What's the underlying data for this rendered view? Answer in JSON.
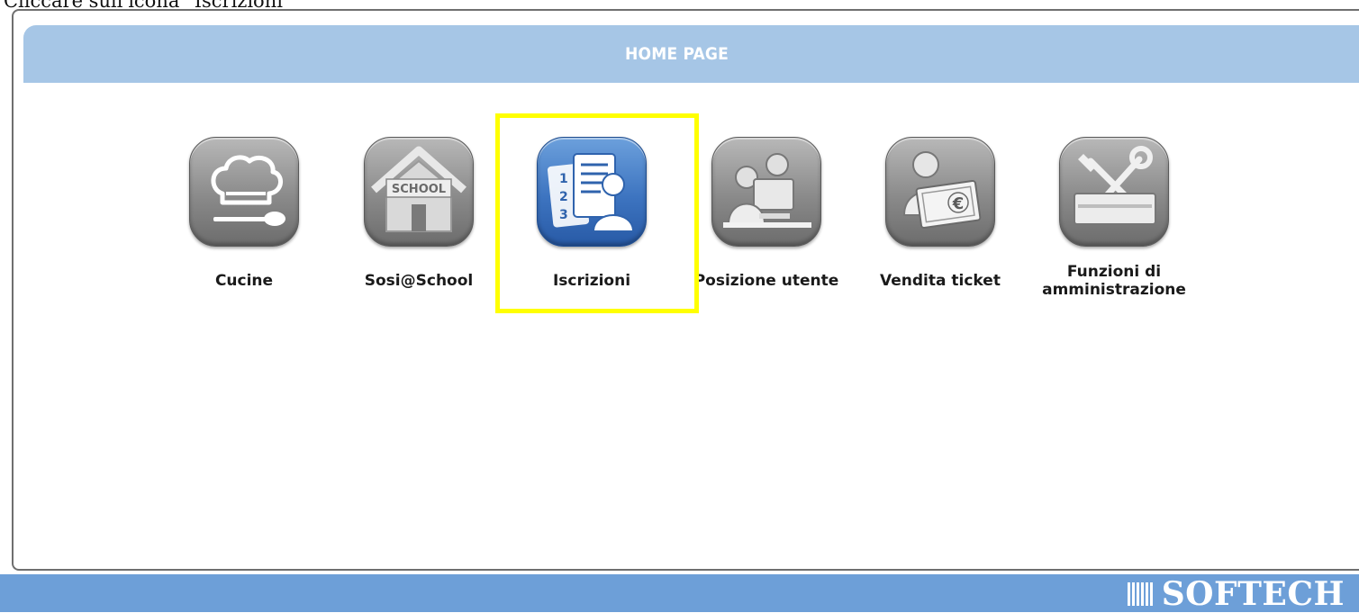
{
  "instruction": "Cliccare sull'icona \"Iscrizioni\"",
  "header": {
    "title": "HOME PAGE"
  },
  "tiles": [
    {
      "label": "Cucine",
      "icon": "chef-hat-icon"
    },
    {
      "label": "Sosi@School",
      "icon": "school-house-icon",
      "icon_text": "SCHOOL"
    },
    {
      "label": "Iscrizioni",
      "icon": "enrollment-list-icon",
      "highlighted": true
    },
    {
      "label": "Posizione utente",
      "icon": "users-at-computer-icon"
    },
    {
      "label": "Vendita ticket",
      "icon": "ticket-sale-euro-icon",
      "icon_text": "€"
    },
    {
      "label_line1": "Funzioni di",
      "label_line2": "amministrazione",
      "icon": "tools-toolbox-icon"
    }
  ],
  "footer": {
    "brand": "SOFTECH"
  },
  "colors": {
    "header_bar": "#a6c6e6",
    "footer_bar": "#6d9fd8",
    "highlight": "#ffff00",
    "icon_grey": "#8a8a8a",
    "icon_blue": "#3d74c0"
  }
}
